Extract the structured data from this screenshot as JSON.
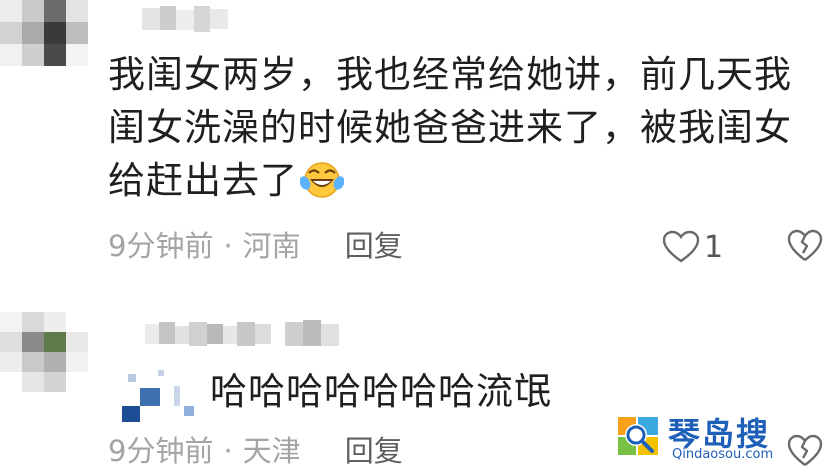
{
  "comments": [
    {
      "text": "我闺女两岁，我也经常给她讲，前几天我闺女洗澡的时候她爸爸进来了，被我闺女给赶出去了",
      "emoji": "laughing-tears-emoji",
      "time": "9分钟前",
      "separator": "·",
      "location": "河南",
      "reply_label": "回复",
      "like_count": "1"
    },
    {
      "text": "哈哈哈哈哈哈哈流氓",
      "time": "9分钟前",
      "separator": "·",
      "location": "天津",
      "reply_label": "回复"
    }
  ],
  "watermark": {
    "name": "琴岛搜",
    "url": "Qindaosou.com"
  },
  "icons": {
    "like": "heart-outline-icon",
    "dislike": "broken-heart-icon"
  },
  "colors": {
    "text": "#1f1f1f",
    "meta": "#a4a4a4",
    "reply": "#5f5f5f",
    "watermark": "#1e5fb8"
  }
}
